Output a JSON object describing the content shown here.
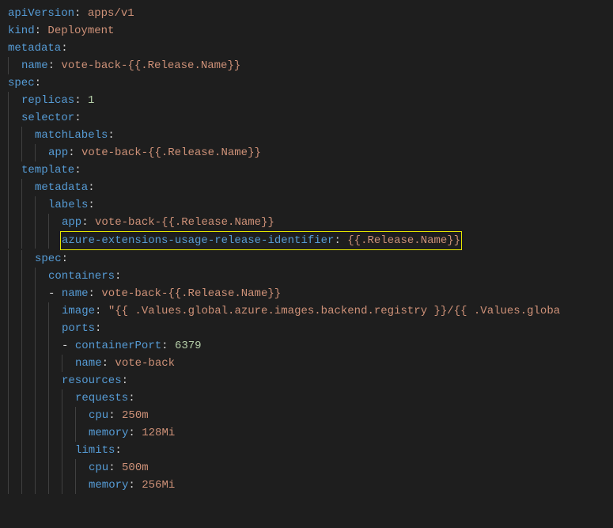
{
  "colors": {
    "bg": "#1e1e1e",
    "key": "#569cd6",
    "string": "#ce9178",
    "number": "#b5cea8",
    "guide": "#404040",
    "highlight_border": "#e6e600"
  },
  "yaml": {
    "apiVersion": {
      "key": "apiVersion",
      "value": "apps/v1"
    },
    "kind": {
      "key": "kind",
      "value": "Deployment"
    },
    "metadata": {
      "key": "metadata",
      "name": {
        "key": "name",
        "value": "vote-back-{{.Release.Name}}"
      }
    },
    "spec": {
      "key": "spec",
      "replicas": {
        "key": "replicas",
        "value": "1"
      },
      "selector": {
        "key": "selector",
        "matchLabels": {
          "key": "matchLabels",
          "app": {
            "key": "app",
            "value": "vote-back-{{.Release.Name}}"
          }
        }
      },
      "template": {
        "key": "template",
        "metadata": {
          "key": "metadata",
          "labels": {
            "key": "labels",
            "app": {
              "key": "app",
              "value": "vote-back-{{.Release.Name}}"
            },
            "azureExt": {
              "key": "azure-extensions-usage-release-identifier",
              "value": "{{.Release.Name}}"
            }
          }
        },
        "spec": {
          "key": "spec",
          "containers": {
            "key": "containers",
            "dash": "-",
            "name": {
              "key": "name",
              "value": "vote-back-{{.Release.Name}}"
            },
            "image": {
              "key": "image",
              "value": "\"{{ .Values.global.azure.images.backend.registry }}/{{ .Values.globa"
            },
            "ports": {
              "key": "ports",
              "dash": "-",
              "containerPort": {
                "key": "containerPort",
                "value": "6379"
              },
              "name": {
                "key": "name",
                "value": "vote-back"
              }
            },
            "resources": {
              "key": "resources",
              "requests": {
                "key": "requests",
                "cpu": {
                  "key": "cpu",
                  "value": "250m"
                },
                "memory": {
                  "key": "memory",
                  "value": "128Mi"
                }
              },
              "limits": {
                "key": "limits",
                "cpu": {
                  "key": "cpu",
                  "value": "500m"
                },
                "memory": {
                  "key": "memory",
                  "value": "256Mi"
                }
              }
            }
          }
        }
      }
    }
  }
}
